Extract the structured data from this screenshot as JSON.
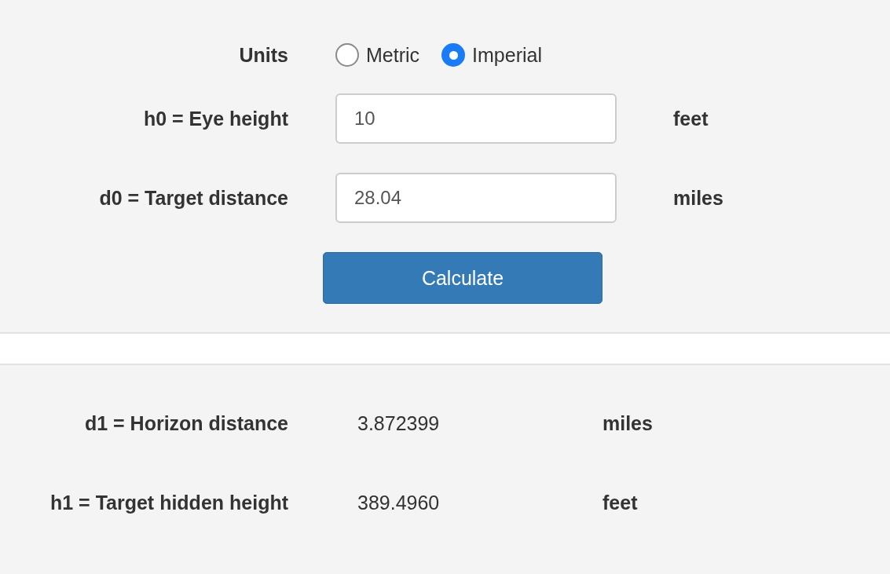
{
  "units": {
    "label": "Units",
    "options": [
      {
        "label": "Metric",
        "selected": false
      },
      {
        "label": "Imperial",
        "selected": true
      }
    ]
  },
  "inputs": [
    {
      "label": "h0 = Eye height",
      "value": "10",
      "unit": "feet"
    },
    {
      "label": "d0 = Target distance",
      "value": "28.04",
      "unit": "miles"
    }
  ],
  "button": "Calculate",
  "results": [
    {
      "label": "d1 = Horizon distance",
      "value": "3.872399",
      "unit": "miles"
    },
    {
      "label": "h1 = Target hidden height",
      "value": "389.4960",
      "unit": "feet"
    }
  ]
}
